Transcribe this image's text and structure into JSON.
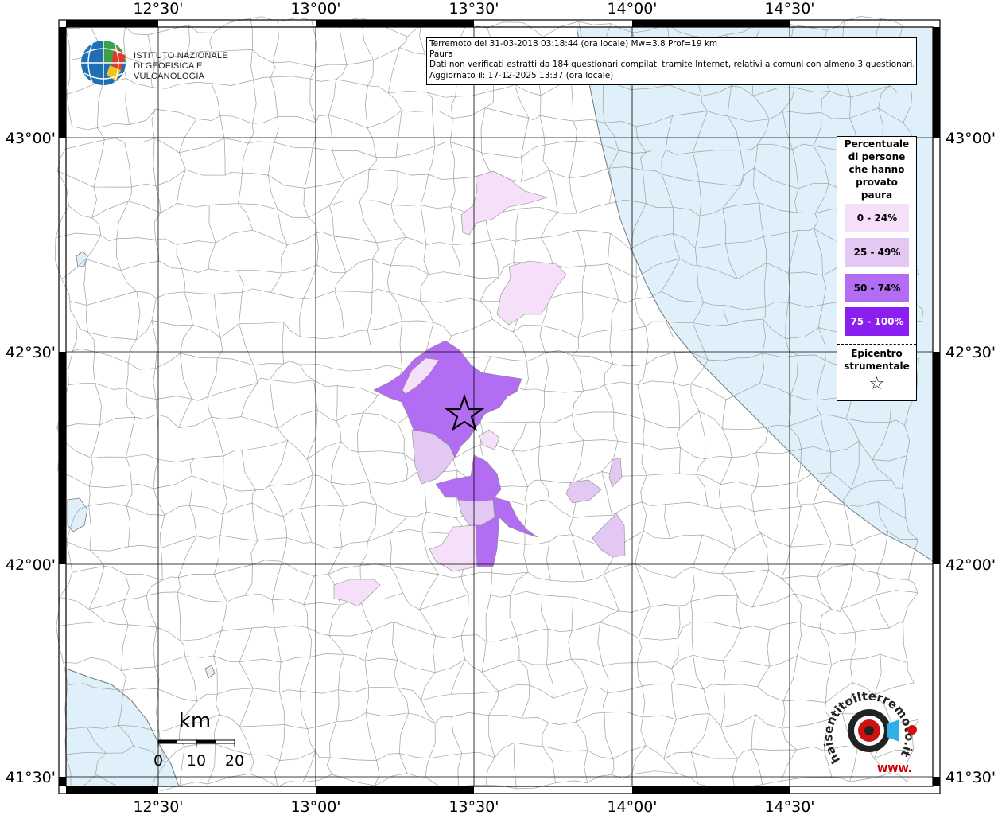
{
  "map": {
    "lon_labels": [
      "12°30'",
      "13°00'",
      "13°30'",
      "14°00'",
      "14°30'"
    ],
    "lat_labels": [
      "43°00'",
      "42°30'",
      "42°00'",
      "41°30'"
    ],
    "colors": {
      "sea": "#dff0fb",
      "land": "#ffffff",
      "borders": "#9a9a9a",
      "grid": "#000000",
      "class_0_24": "#f6dff8",
      "class_25_49": "#e2c8f2",
      "class_50_74": "#b36df2",
      "class_75_100": "#8b1ef0"
    },
    "epicenter": {
      "lat": 42.37,
      "lon": 13.47
    }
  },
  "info": {
    "line1": "Terremoto del 31-03-2018 03:18:44 (ora locale) Mw=3.8 Prof=19 km",
    "line2": "Paura",
    "line3": "Dati non verificati estratti da 184 questionari compilati tramite Internet, relativi a comuni con almeno 3 questionari.",
    "line4": "Aggiornato il: 17-12-2025 13:37 (ora locale)"
  },
  "logo_ingv": {
    "line1": "ISTITUTO NAZIONALE",
    "line2": "DI GEOFISICA E VULCANOLOGIA"
  },
  "legend": {
    "title_lines": [
      "Percentuale",
      "di persone",
      "che hanno",
      "provato",
      "paura"
    ],
    "items": [
      {
        "label": "0 - 24%",
        "color": "#f6dff8"
      },
      {
        "label": "25 - 49%",
        "color": "#e2c8f2"
      },
      {
        "label": "50 - 74%",
        "color": "#b36df2"
      },
      {
        "label": "75 - 100%",
        "color": "#8b1ef0"
      }
    ],
    "epicenter_lines": [
      "Epicentro",
      "strumentale"
    ],
    "epicenter_symbol": "☆"
  },
  "scale": {
    "unit": "km",
    "ticks": [
      "0",
      "10",
      "20"
    ]
  },
  "logo_ht": {
    "text": "haisentitoilterremoto.it",
    "url_text": "WWW."
  }
}
